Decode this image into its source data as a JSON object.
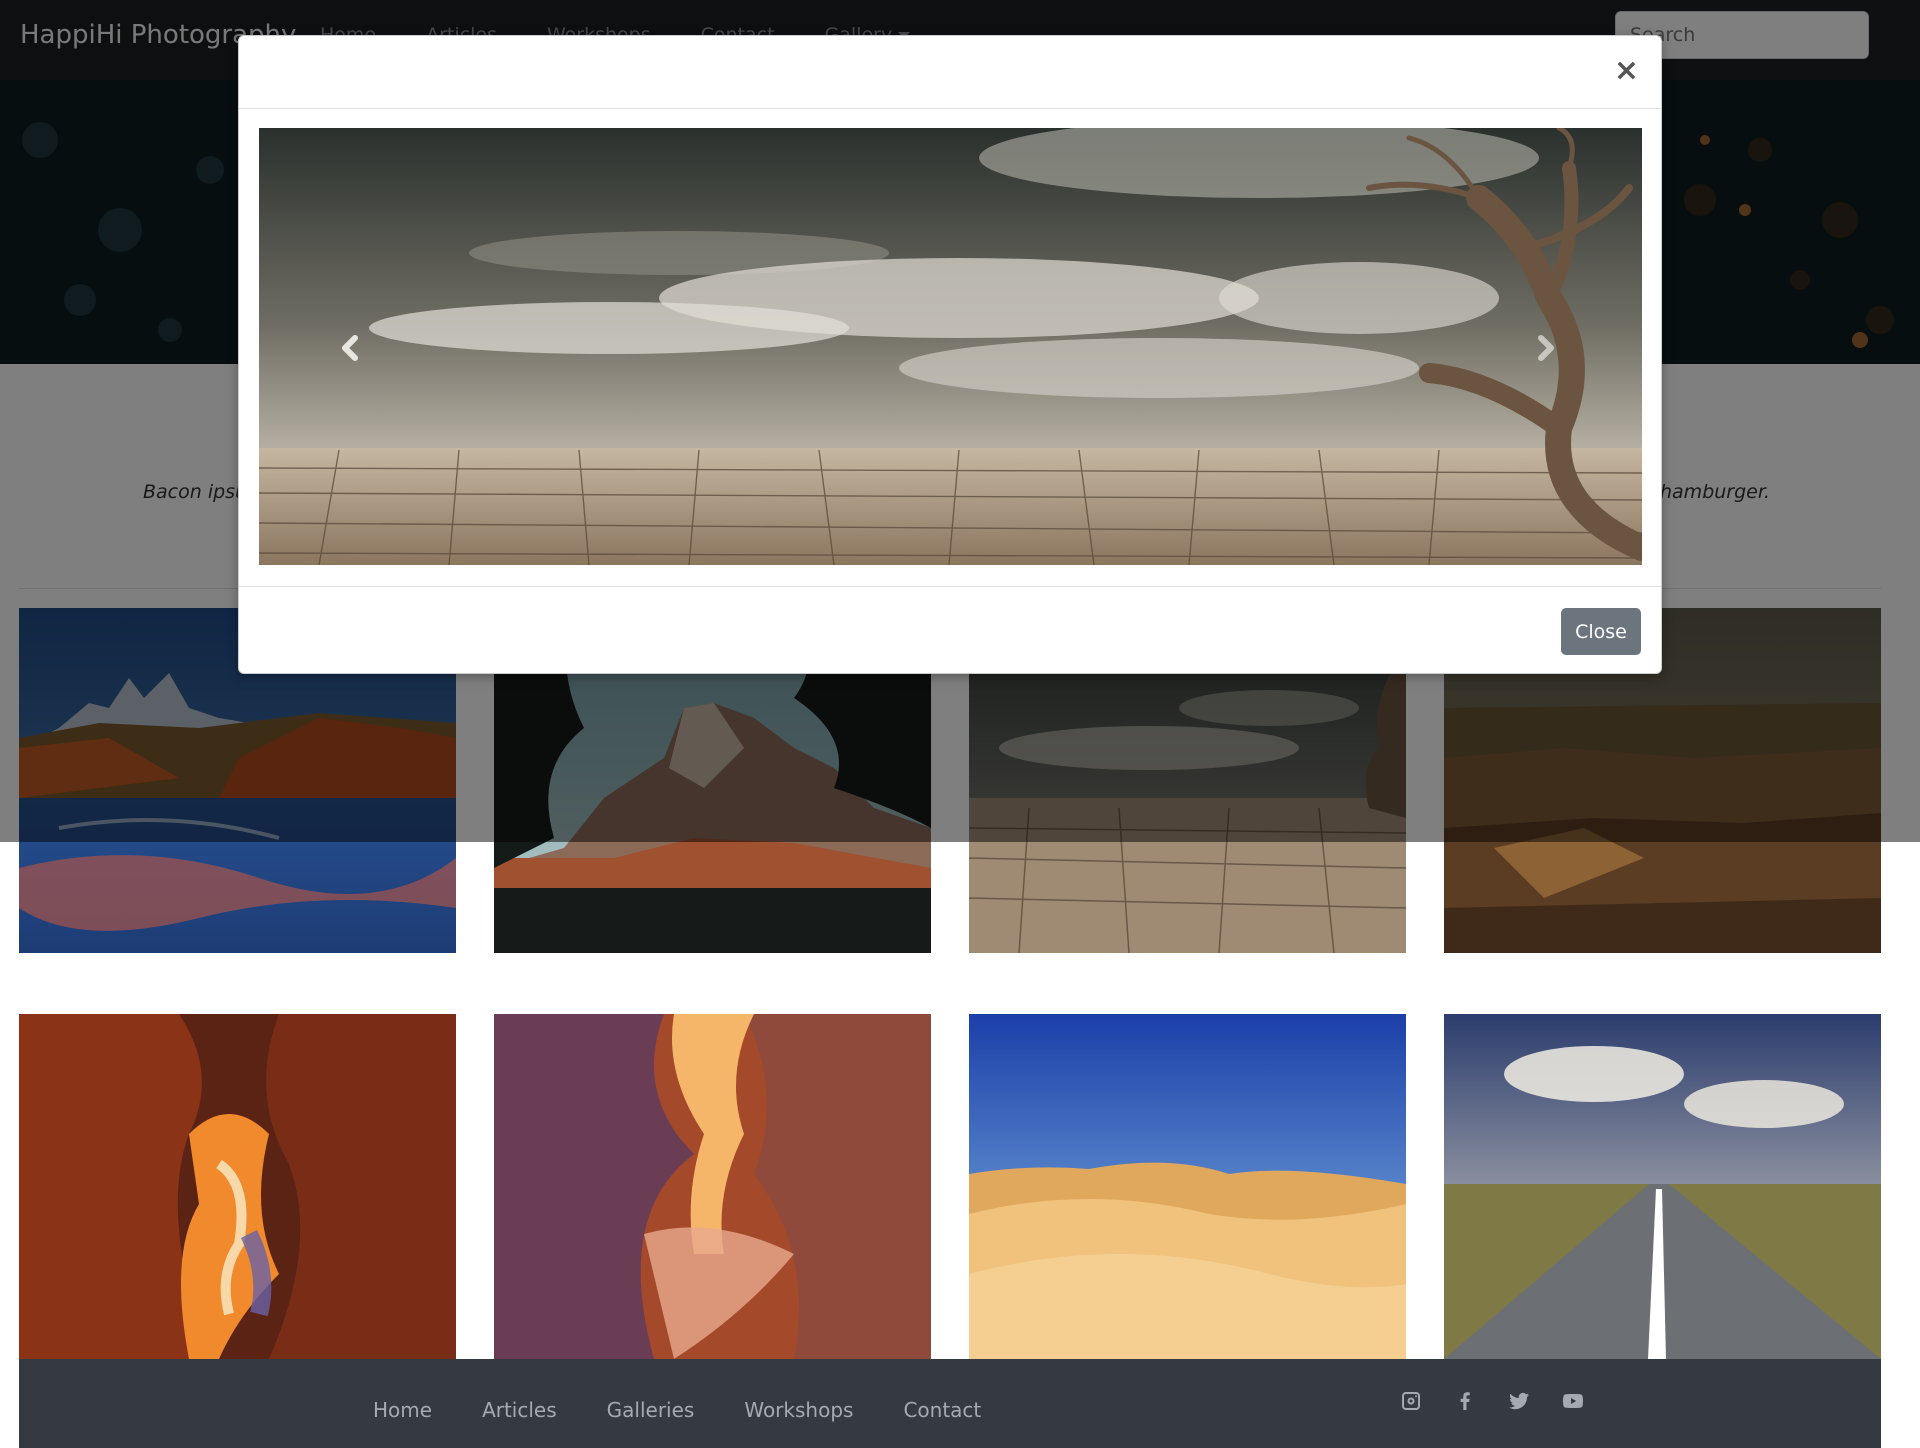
{
  "navbar": {
    "brand": "HappiHi Photography",
    "links": [
      "Home",
      "Articles",
      "Workshops",
      "Contact",
      "Gallery"
    ],
    "search_placeholder": "Search"
  },
  "intro": {
    "text_left": "Bacon ipsum",
    "text_right": "hamburger."
  },
  "footer": {
    "links": [
      "Home",
      "Articles",
      "Galleries",
      "Workshops",
      "Contact"
    ],
    "social_icons": [
      "instagram-icon",
      "facebook-icon",
      "twitter-icon",
      "youtube-icon"
    ]
  },
  "modal": {
    "close_symbol": "×",
    "close_button": "Close",
    "carousel_icons": [
      "chevron-left-icon",
      "chevron-right-icon"
    ]
  },
  "colors": {
    "navbar": "#1b1f23",
    "footer": "#343a40",
    "close_button": "#6c757d"
  }
}
